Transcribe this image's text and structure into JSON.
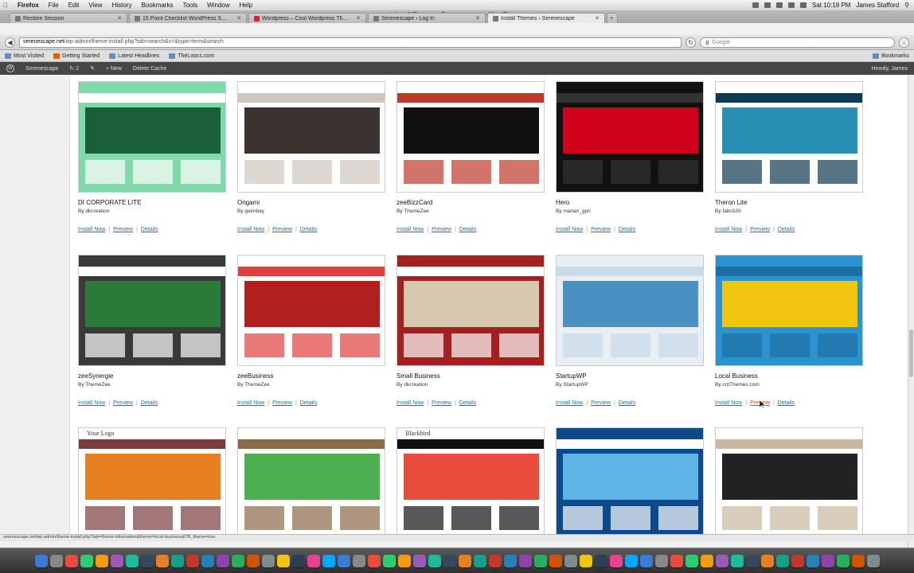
{
  "menubar": {
    "app": "Firefox",
    "menus": [
      "File",
      "Edit",
      "View",
      "History",
      "Bookmarks",
      "Tools",
      "Window",
      "Help"
    ],
    "clock": "Sat 10:18 PM",
    "user": "James Stafford"
  },
  "window": {
    "title": "Install Themes ‹ Serenescape — WordPress"
  },
  "tabs": [
    {
      "label": "Restore Session",
      "active": false
    },
    {
      "label": "15 Point Checklist WordPress S…",
      "active": false
    },
    {
      "label": "Wordpress – Cool Wordpress Th…",
      "active": false
    },
    {
      "label": "Serenescape › Log In",
      "active": false
    },
    {
      "label": "Install Themes ‹ Serenescape",
      "active": true
    }
  ],
  "nav": {
    "url_host": "serenescape.net",
    "url_path": "/wp-admin/theme-install.php?tab=search&s=&type=term&search",
    "search_placeholder": "Google",
    "search_engine_glyph": "g"
  },
  "bookmarks": [
    {
      "label": "Most Visited"
    },
    {
      "label": "Getting Started"
    },
    {
      "label": "Latest Headlines"
    },
    {
      "label": "TheLoocs.com"
    }
  ],
  "bookmarks_right": "Bookmarks",
  "adminbar": {
    "site": "Serenescape",
    "updates": "2",
    "new": "+ New",
    "delete_cache": "Delete Cache",
    "howdy": "Howdy, James"
  },
  "actions": {
    "install": "Install Now",
    "preview": "Preview",
    "details": "Details"
  },
  "themes": [
    {
      "name": "DI CORPORATE LITE",
      "author": "By dkcreation",
      "colors": [
        "#7fd9a8",
        "#1b5e3a",
        "#ffffff"
      ]
    },
    {
      "name": "Origami",
      "author": "By gaimbay",
      "colors": [
        "#ffffff",
        "#3a3330",
        "#cfc6bd"
      ]
    },
    {
      "name": "zeeBizzCard",
      "author": "By ThemeZee",
      "colors": [
        "#ffffff",
        "#111111",
        "#c0392b"
      ]
    },
    {
      "name": "Hero",
      "author": "By marian_gpri",
      "colors": [
        "#111111",
        "#d0021b",
        "#333333"
      ]
    },
    {
      "name": "Theron Lite",
      "author": "By fabri100",
      "colors": [
        "#ffffff",
        "#2a8fb5",
        "#0e3a52"
      ]
    },
    {
      "name": "zeeSynergie",
      "author": "By ThemeZee",
      "colors": [
        "#3a3a3a",
        "#2a7a3a",
        "#ffffff"
      ]
    },
    {
      "name": "zeeBusiness",
      "author": "By ThemeZee",
      "colors": [
        "#ffffff",
        "#b21f1f",
        "#e04040"
      ]
    },
    {
      "name": "Small Business",
      "author": "By dkcreation",
      "colors": [
        "#a32020",
        "#d9c8b0",
        "#ffffff"
      ]
    },
    {
      "name": "StartupWP",
      "author": "By StartupWP",
      "colors": [
        "#e9eef2",
        "#4a90c2",
        "#c9dae8"
      ]
    },
    {
      "name": "Local Business",
      "author": "By cntThemes.com",
      "colors": [
        "#2b93cf",
        "#f1c40f",
        "#1d6fa3"
      ]
    },
    {
      "name": "",
      "author": "",
      "preview_text": "Your Logo",
      "colors": [
        "#ffffff",
        "#e67e22",
        "#7a3d3d"
      ]
    },
    {
      "name": "",
      "author": "",
      "colors": [
        "#ffffff",
        "#4caf50",
        "#8b6a4a"
      ]
    },
    {
      "name": "",
      "author": "",
      "preview_text": "Blackbird",
      "colors": [
        "#ffffff",
        "#e74c3c",
        "#111111"
      ]
    },
    {
      "name": "",
      "author": "",
      "colors": [
        "#0d4a8c",
        "#5fb4e6",
        "#ffffff"
      ]
    },
    {
      "name": "",
      "author": "",
      "colors": [
        "#ffffff",
        "#222222",
        "#c9b8a0"
      ]
    }
  ],
  "statusbar": "serenescape.net/wp-admin/theme-install.php?tab=theme-information&theme=local-business&TB_iframe=true"
}
